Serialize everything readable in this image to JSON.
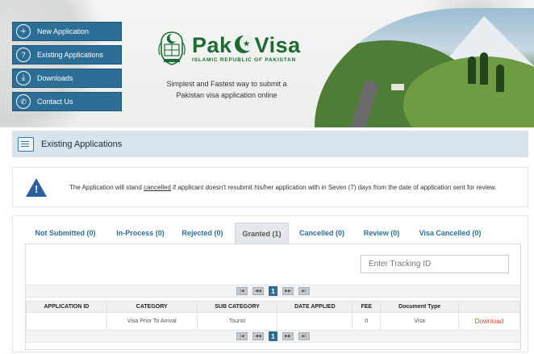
{
  "banner": {
    "brand_name_left": "Pak",
    "brand_name_right": "Visa",
    "brand_subtitle": "ISLAMIC REPUBLIC OF PAKISTAN",
    "tagline_line1": "Simplest and Fastest way to submit a",
    "tagline_line2": "Pakistan visa application online",
    "brand_color": "#1d6b33"
  },
  "menu": [
    {
      "label": "New Application",
      "icon": "plus-circle-icon"
    },
    {
      "label": "Existing Applications",
      "icon": "speech-bubble-icon"
    },
    {
      "label": "Downloads",
      "icon": "download-circle-icon"
    },
    {
      "label": "Contact Us",
      "icon": "phone-circle-icon"
    }
  ],
  "section": {
    "title": "Existing Applications",
    "icon": "document-list-icon"
  },
  "notice": {
    "icon": "warning-triangle-icon",
    "text_before": "The Application will stand ",
    "text_underlined": "cancelled",
    "text_after": " if applicant doesn't resubmit his/her application with in Seven (7) days from the date of application sent for review."
  },
  "tabs": [
    {
      "label": "Not Submitted (0)",
      "active": false
    },
    {
      "label": "In-Process (0)",
      "active": false
    },
    {
      "label": "Rejected (0)",
      "active": false
    },
    {
      "label": "Granted (1)",
      "active": true
    },
    {
      "label": "Cancelled (0)",
      "active": false
    },
    {
      "label": "Review (0)",
      "active": false
    },
    {
      "label": "Visa Cancelled (0)",
      "active": false
    }
  ],
  "search": {
    "placeholder": "Enter Tracking ID",
    "value": ""
  },
  "pager": {
    "first": "|◀",
    "prev": "◀◀",
    "current_page": "1",
    "next": "▶▶",
    "last": "▶|"
  },
  "table": {
    "columns": [
      "APPLICATION ID",
      "CATEGORY",
      "SUB CATEGORY",
      "DATE APPLIED",
      "FEE",
      "Document Type",
      ""
    ],
    "rows": [
      [
        "",
        "Visa Prior To Arrival",
        "Tourist",
        "",
        "0",
        "Visa",
        "Download"
      ]
    ]
  },
  "colors": {
    "accent": "#2c6e96",
    "link_download": "#c4512c",
    "section_bar": "#d8e3ec"
  }
}
